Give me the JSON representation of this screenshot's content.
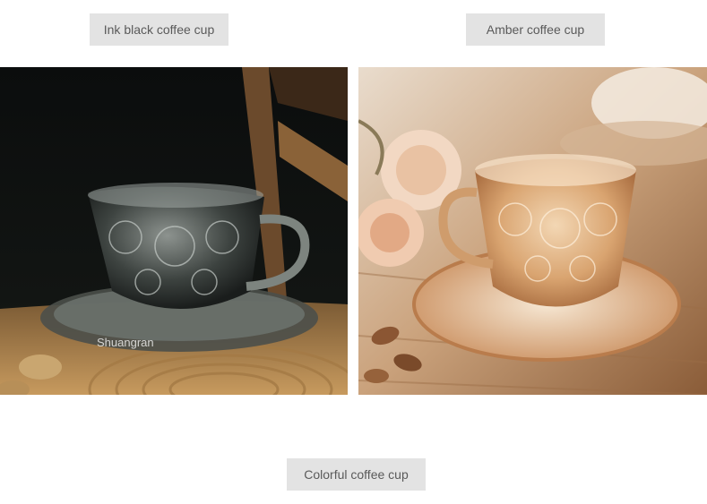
{
  "labels": {
    "ink_black": "Ink black coffee cup",
    "amber": "Amber coffee cup",
    "colorful": "Colorful coffee cup"
  },
  "photos": {
    "left": {
      "subject": "clear glass coffee cup with saucer on wooden surface, dark background",
      "watermark": "Shuangran"
    },
    "right": {
      "subject": "amber glass coffee cup with saucer, roses and almonds on wooden table"
    }
  }
}
